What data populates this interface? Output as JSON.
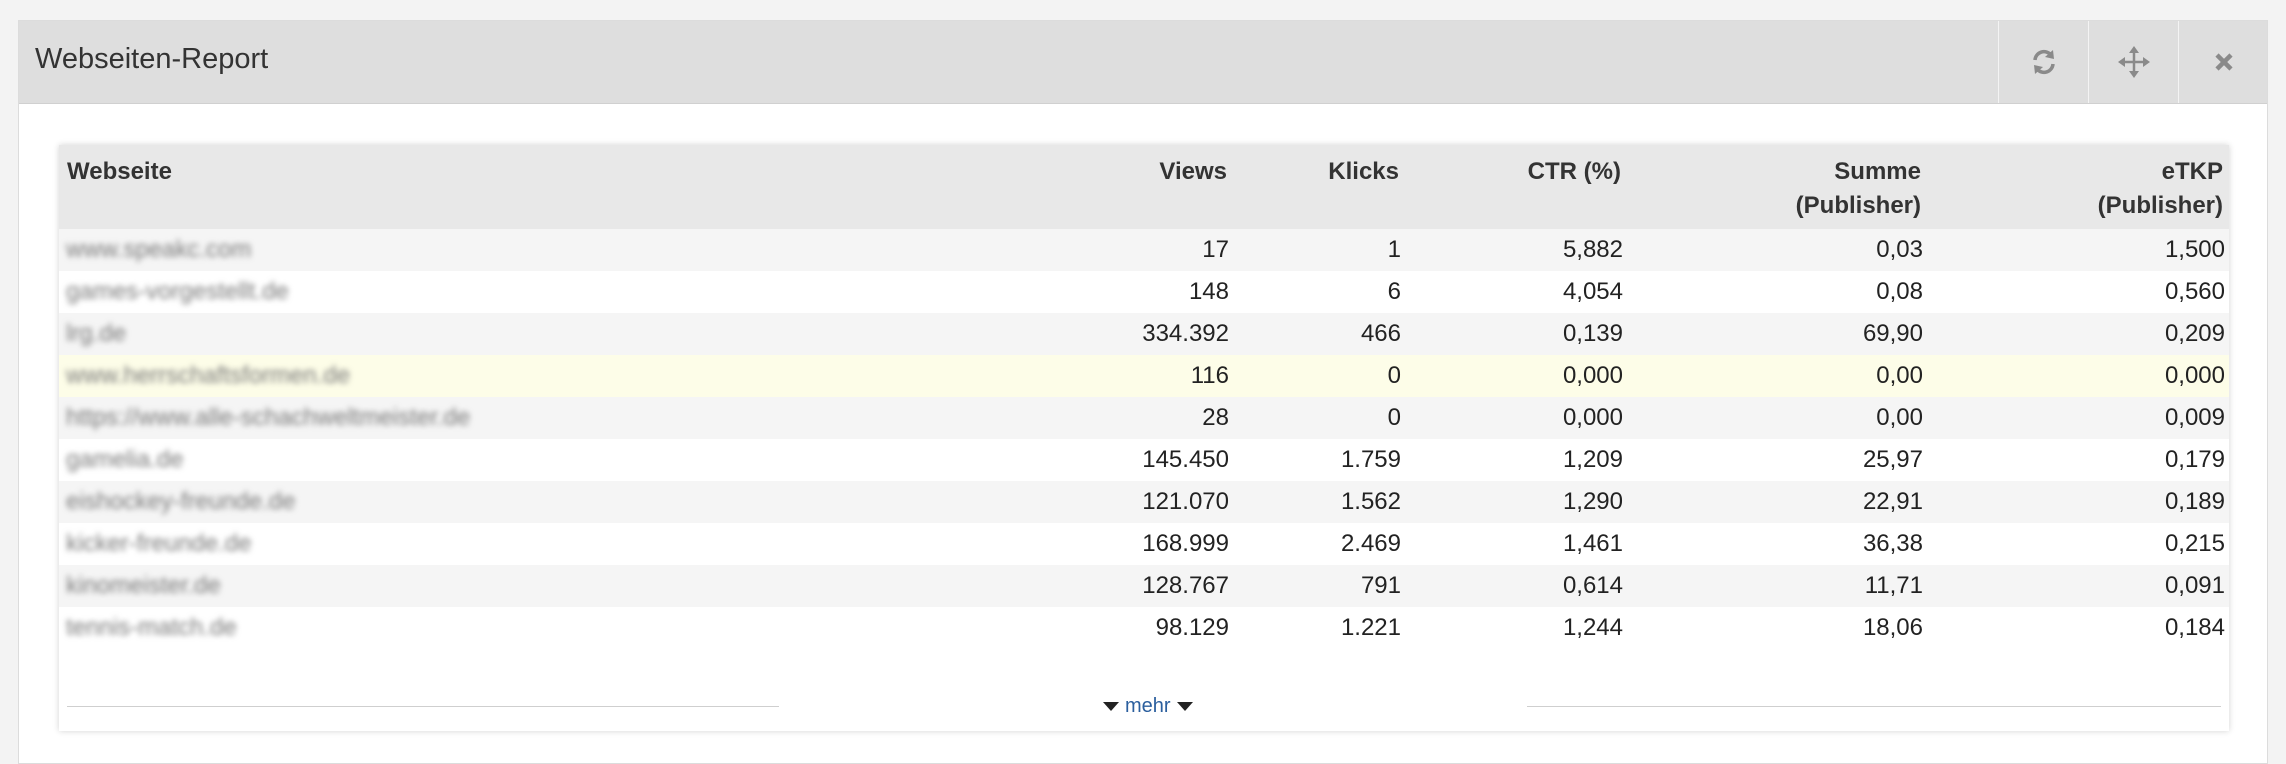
{
  "widget": {
    "title": "Webseiten-Report",
    "buttons": [
      {
        "icon": "refresh-icon"
      },
      {
        "icon": "move-icon"
      },
      {
        "icon": "close-icon"
      }
    ]
  },
  "table": {
    "headers": {
      "site": "Webseite",
      "views": "Views",
      "klicks": "Klicks",
      "ctr": "CTR (%)",
      "summe_l1": "Summe",
      "summe_l2": "(Publisher)",
      "etkp_l1": "eTKP",
      "etkp_l2": "(Publisher)"
    },
    "rows": [
      {
        "site": "www.speakc.com",
        "views": "17",
        "klicks": "1",
        "ctr": "5,882",
        "summe": "0,03",
        "etkp": "1,500"
      },
      {
        "site": "games-vorgestellt.de",
        "views": "148",
        "klicks": "6",
        "ctr": "4,054",
        "summe": "0,08",
        "etkp": "0,560"
      },
      {
        "site": "lrg.de",
        "views": "334.392",
        "klicks": "466",
        "ctr": "0,139",
        "summe": "69,90",
        "etkp": "0,209"
      },
      {
        "site": "www.herrschaftsformen.de",
        "views": "116",
        "klicks": "0",
        "ctr": "0,000",
        "summe": "0,00",
        "etkp": "0,000"
      },
      {
        "site": "https://www.alle-schachweltmeister.de",
        "views": "28",
        "klicks": "0",
        "ctr": "0,000",
        "summe": "0,00",
        "etkp": "0,009"
      },
      {
        "site": "gamelia.de",
        "views": "145.450",
        "klicks": "1.759",
        "ctr": "1,209",
        "summe": "25,97",
        "etkp": "0,179"
      },
      {
        "site": "eishockey-freunde.de",
        "views": "121.070",
        "klicks": "1.562",
        "ctr": "1,290",
        "summe": "22,91",
        "etkp": "0,189"
      },
      {
        "site": "kicker-freunde.de",
        "views": "168.999",
        "klicks": "2.469",
        "ctr": "1,461",
        "summe": "36,38",
        "etkp": "0,215"
      },
      {
        "site": "kinomeister.de",
        "views": "128.767",
        "klicks": "791",
        "ctr": "0,614",
        "summe": "11,71",
        "etkp": "0,091"
      },
      {
        "site": "tennis-match.de",
        "views": "98.129",
        "klicks": "1.221",
        "ctr": "1,244",
        "summe": "18,06",
        "etkp": "0,184"
      }
    ],
    "more_label": "mehr"
  }
}
